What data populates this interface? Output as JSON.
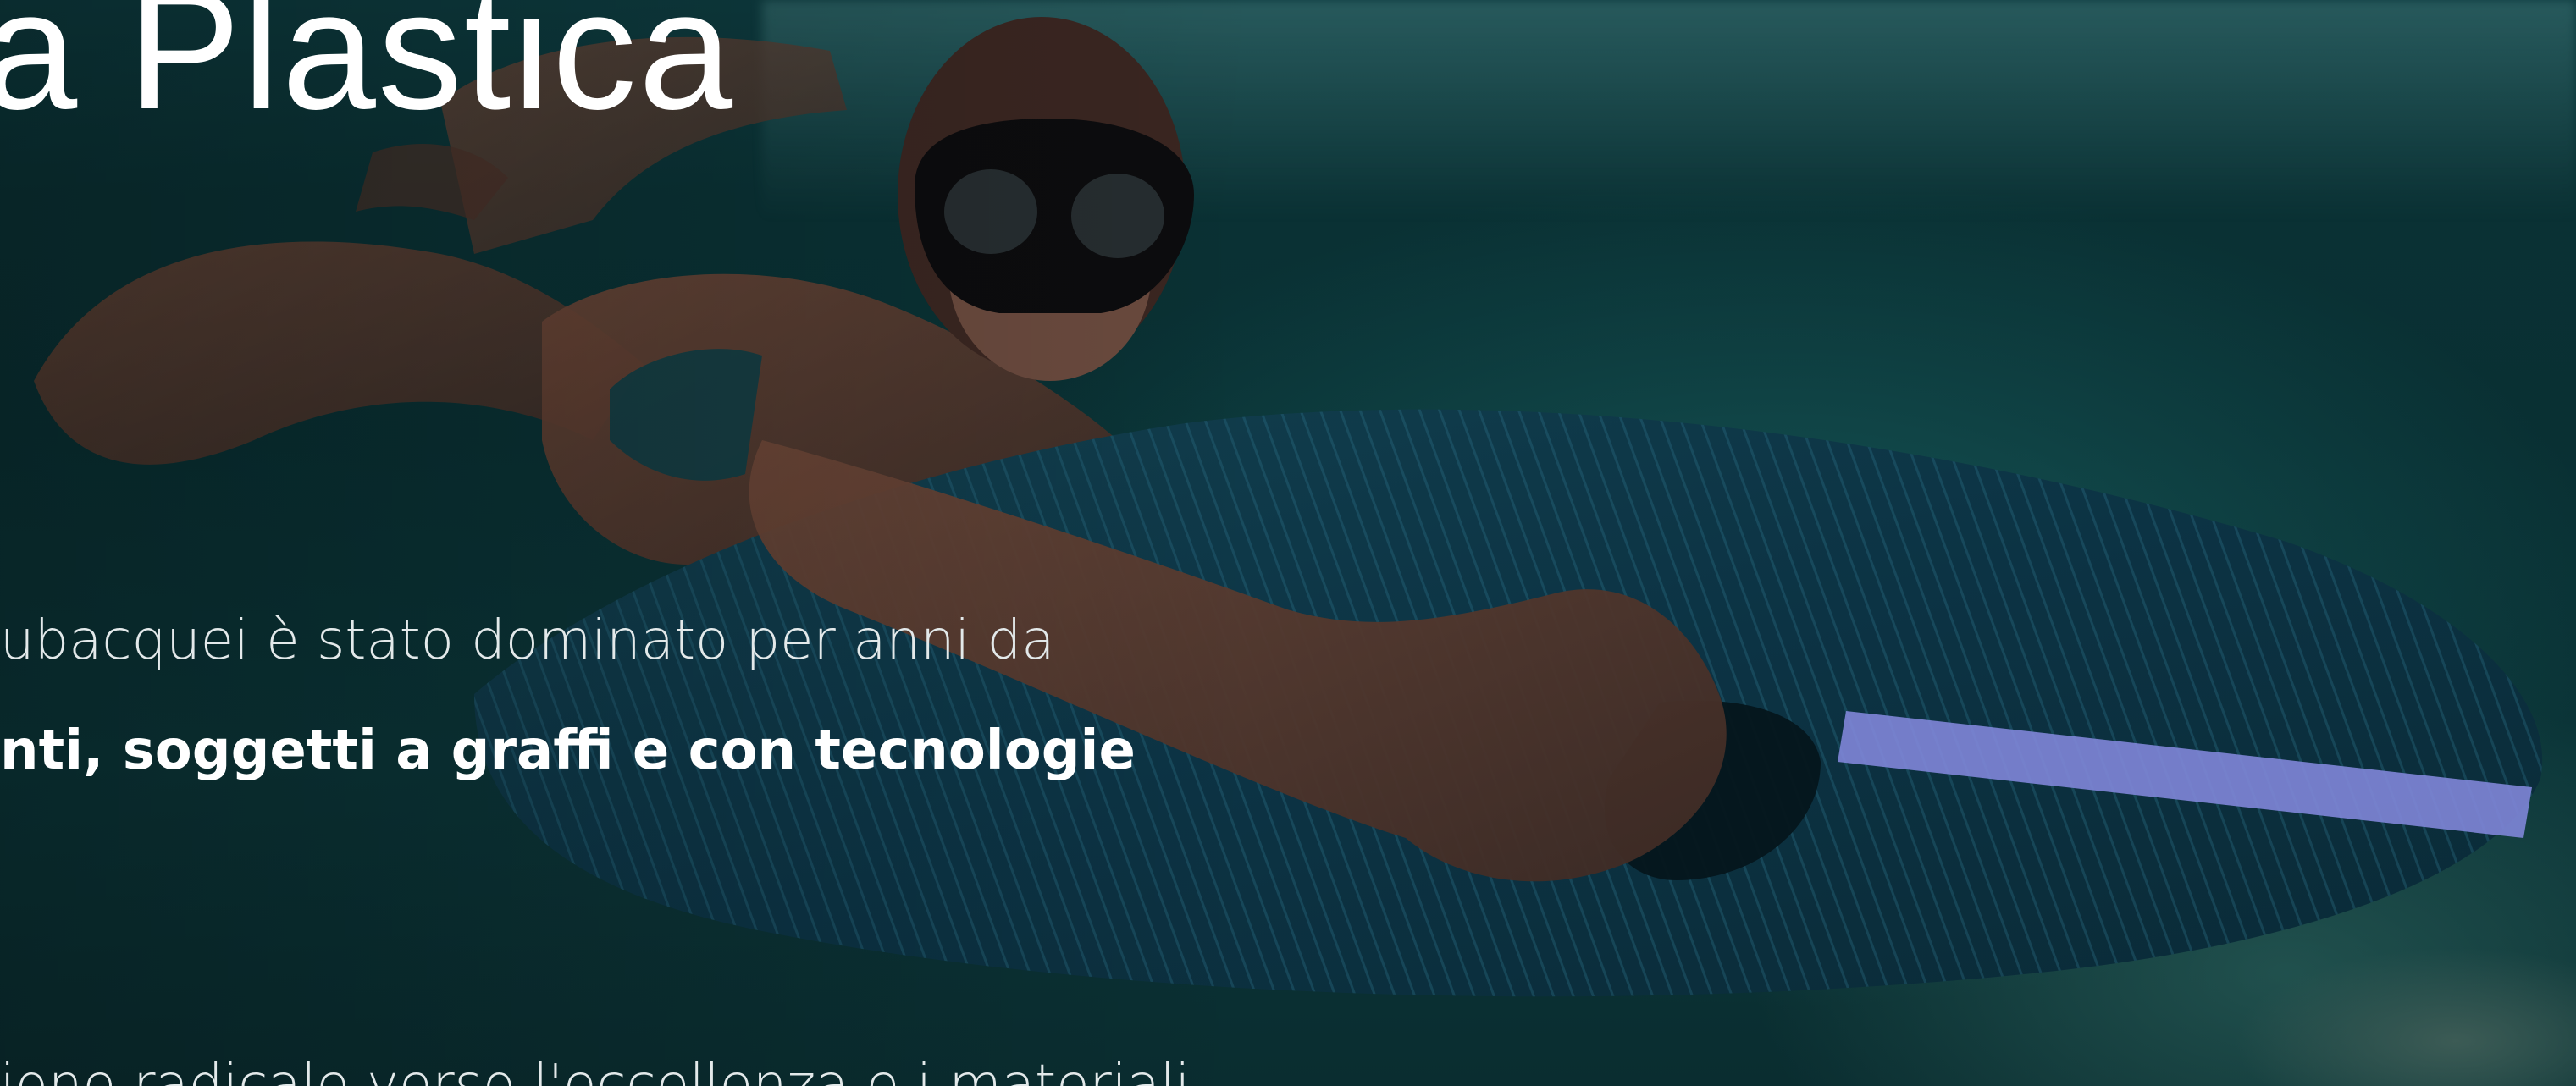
{
  "hero": {
    "headline": "a Plastica",
    "paragraph_line_1": "ubacquei è stato dominato per anni da",
    "paragraph_line_2_bold": "nti, soggetti a graffi e con tecnologie",
    "paragraph_line_3": "ione radicale verso l'eccellenza e i materiali"
  },
  "colors": {
    "water_dark": "#082a2d",
    "water_mid": "#0d3a3e",
    "text": "#ffffff",
    "board_stripe": "#7f86d8"
  },
  "background_image": {
    "icon": "underwater-diver-with-carbon-board"
  }
}
